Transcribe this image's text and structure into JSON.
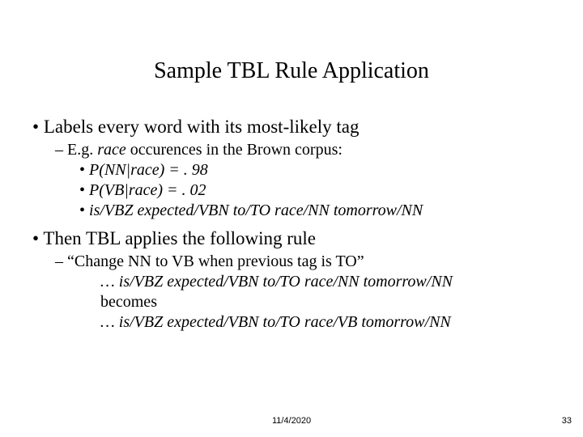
{
  "title": "Sample TBL Rule Application",
  "bullets": {
    "p1": "Labels every word with its most-likely tag",
    "p1_sub1_lead": "E.g. ",
    "p1_sub1_race": "race",
    "p1_sub1_tail": " occurences in the Brown corpus:",
    "p1_sub1_a": "P(NN|race) = . 98",
    "p1_sub1_b": "P(VB|race) = . 02",
    "p1_sub1_c": "is/VBZ expected/VBN to/TO race/NN tomorrow/NN",
    "p2": "Then TBL applies the following rule",
    "p2_sub1": "“Change NN to VB when previous tag is TO”",
    "p2_line1": "… is/VBZ expected/VBN to/TO race/NN tomorrow/NN",
    "p2_line2": "becomes",
    "p2_line3": "… is/VBZ expected/VBN to/TO race/VB tomorrow/NN"
  },
  "footer": {
    "date": "11/4/2020",
    "page": "33"
  }
}
